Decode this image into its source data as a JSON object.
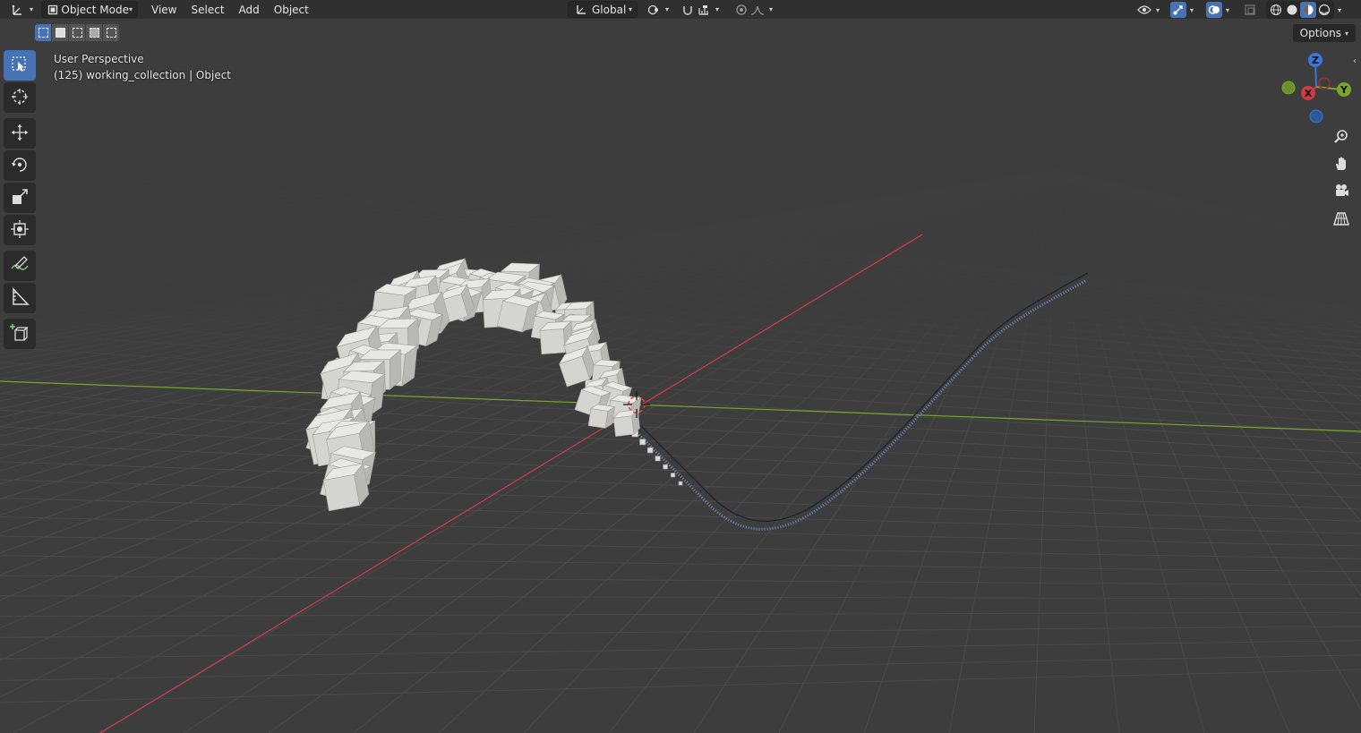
{
  "header": {
    "editor_type_icon": "axis-icon",
    "mode": "Object Mode",
    "menus": [
      "View",
      "Select",
      "Add",
      "Object"
    ],
    "transform_orientation": "Global",
    "pivot_icon": "pivot-icon",
    "snap_icon": "magnet-icon",
    "snap_target_icon": "snap-increment-icon",
    "proportional_icon": "proportional-edit-icon",
    "falloff_icon": "falloff-curve-icon",
    "visibility_icon": "eye-icon",
    "gizmo_icon": "gizmo-icon",
    "overlay_icon": "overlay-icon",
    "xray_icon": "xray-icon",
    "shading_icons": [
      "wireframe-icon",
      "solid-icon",
      "material-preview-icon",
      "rendered-icon"
    ],
    "active_shading": 2
  },
  "viewport": {
    "perspective_label": "User Perspective",
    "collection_label": "(125) working_collection | Object",
    "options_label": "Options"
  },
  "selection_modes": [
    "select-new-icon",
    "select-extend-icon",
    "select-subtract-icon",
    "select-difference-icon",
    "select-intersect-icon"
  ],
  "toolbar": {
    "tools": [
      "select-box-icon",
      "cursor-icon",
      "move-icon",
      "rotate-icon",
      "scale-icon",
      "transform-icon",
      "annotate-icon",
      "measure-icon",
      "add-cube-icon"
    ],
    "active_tool": 0
  },
  "navigation": {
    "axes": [
      "X",
      "Y",
      "Z"
    ],
    "buttons": [
      "zoom-icon",
      "hand-icon",
      "camera-icon",
      "grid-icon"
    ]
  },
  "colors": {
    "x_axis": "#d23a4a",
    "y_axis": "#78a62a",
    "z_axis": "#3a77d6",
    "accent": "#4772b3",
    "background": "#3d3d3d"
  }
}
